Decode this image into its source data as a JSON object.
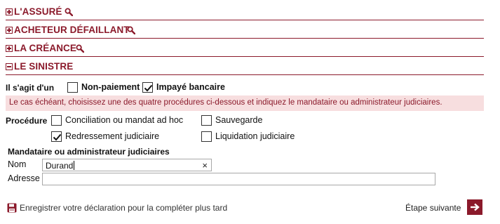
{
  "sections": {
    "assure": {
      "title": "L'ASSURÉ",
      "state": "collapsed"
    },
    "acheteur": {
      "title": "ACHETEUR DÉFAILLANT",
      "state": "collapsed"
    },
    "creance": {
      "title": "LA CRÉANCE",
      "state": "collapsed"
    },
    "sinistre": {
      "title": "LE SINISTRE",
      "state": "expanded"
    }
  },
  "sinistre": {
    "type_label": "Il s'agit d'un",
    "options": [
      {
        "label": "Non-paiement",
        "checked": false
      },
      {
        "label": "Impayé bancaire",
        "checked": true
      }
    ],
    "info_text": "Le cas échéant, choisissez une des quatre procédures ci-dessous et indiquez le mandataire ou administrateur judiciaires.",
    "procedure_label": "Procédure",
    "procedures": [
      {
        "label": "Conciliation ou mandat ad hoc",
        "checked": false
      },
      {
        "label": "Sauvegarde",
        "checked": false
      },
      {
        "label": "Redressement judiciaire",
        "checked": true
      },
      {
        "label": "Liquidation judiciaire",
        "checked": false
      }
    ],
    "mandataire_heading": "Mandataire ou administrateur judiciaires",
    "nom_label": "Nom",
    "nom_value": "Durand",
    "clear_symbol": "×",
    "adresse_label": "Adresse",
    "adresse_value": ""
  },
  "footer": {
    "save_label": "Enregistrer votre déclaration pour la compléter plus tard",
    "next_label": "Étape suivante"
  },
  "colors": {
    "accent": "#8b1a2b",
    "info_background": "#f7dedf"
  },
  "icons": {
    "search": "magnifier-icon",
    "toggle_collapsed": "plus-box-icon",
    "toggle_expanded": "minus-box-icon",
    "save": "floppy-disk-icon",
    "next": "arrow-right-icon",
    "checkbox_checked": "check-icon"
  }
}
